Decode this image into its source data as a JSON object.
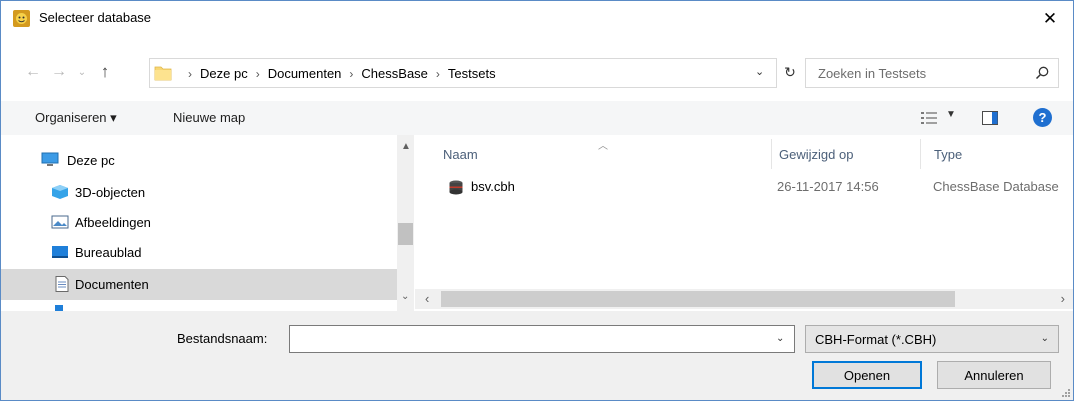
{
  "window": {
    "title": "Selecteer database",
    "close_symbol": "✕"
  },
  "address_bar": {
    "crumbs": [
      "Deze pc",
      "Documenten",
      "ChessBase",
      "Testsets"
    ],
    "separator": "›"
  },
  "search": {
    "placeholder": "Zoeken in Testsets"
  },
  "toolbar": {
    "organize_label": "Organiseren ▾",
    "new_folder_label": "Nieuwe map",
    "help_label": "?"
  },
  "nav_pane": {
    "items": [
      {
        "label": "Deze pc",
        "icon": "pc-icon"
      },
      {
        "label": "3D-objecten",
        "icon": "3d-objects-icon"
      },
      {
        "label": "Afbeeldingen",
        "icon": "pictures-icon"
      },
      {
        "label": "Bureaublad",
        "icon": "desktop-icon"
      },
      {
        "label": "Documenten",
        "icon": "documents-icon",
        "selected": true
      }
    ]
  },
  "file_list": {
    "columns": [
      "Naam",
      "Gewijzigd op",
      "Type"
    ],
    "rows": [
      {
        "name": "bsv.cbh",
        "modified": "26-11-2017 14:56",
        "type": "ChessBase Database",
        "icon": "database-icon"
      }
    ]
  },
  "bottom": {
    "filename_label": "Bestandsnaam:",
    "filename_value": "",
    "filter_value": "CBH-Format (*.CBH)",
    "open_label": "Openen",
    "cancel_label": "Annuleren"
  },
  "colors": {
    "accent": "#0078d7",
    "header_text": "#4c607a",
    "selected_row": "#d9d9d9"
  }
}
